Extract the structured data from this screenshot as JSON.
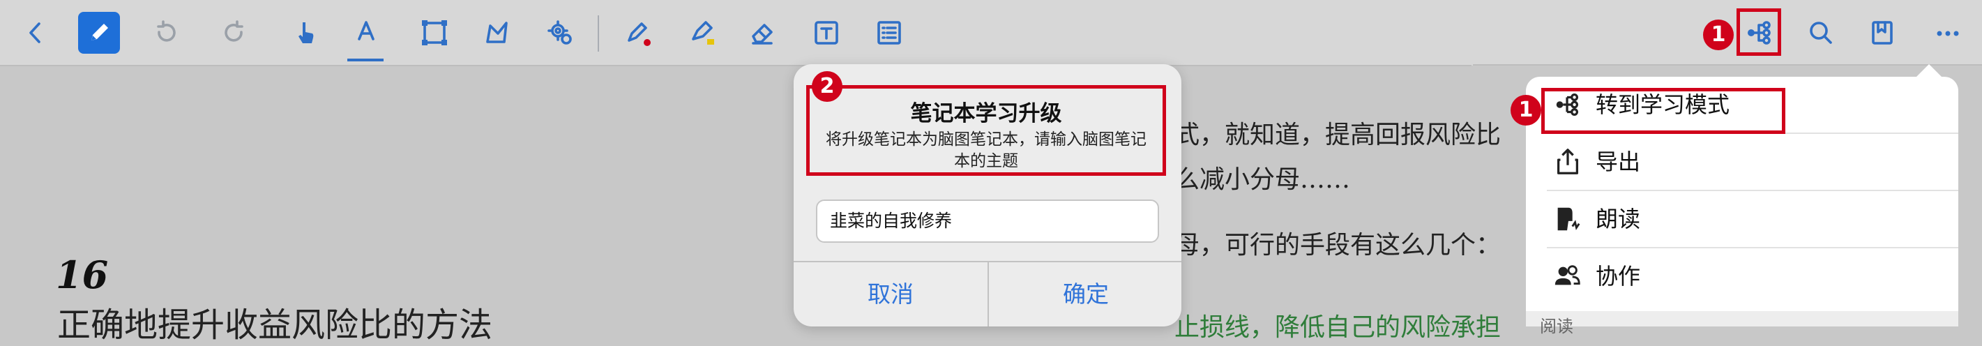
{
  "toolbar": {
    "icons": [
      "back-icon",
      "pencil-icon",
      "undo-icon",
      "redo-icon",
      "hand-icon",
      "text-color-icon",
      "select-rect-icon",
      "lasso-icon",
      "settings-icon",
      "pen-red-icon",
      "highlighter-icon",
      "eraser-icon",
      "textbox-icon",
      "list-icon"
    ],
    "accent": "#2f6fc6"
  },
  "document": {
    "chapter_number": "16",
    "chapter_title": "正确地提升收益风险比的方法",
    "line1": "式，就知道，提高回报风险比",
    "line2": "么减小分母……",
    "line3": "母，可行的手段有这么几个：",
    "line4": "止损线，降低自己的风险承担"
  },
  "dialog": {
    "badge": "2",
    "title": "笔记本学习升级",
    "message": "将升级笔记本为脑图笔记本，请输入脑图笔记本的主题",
    "input_value": "韭菜的自我修养",
    "cancel_label": "取消",
    "confirm_label": "确定"
  },
  "top_right": {
    "badge": "1",
    "icons": [
      "mindmap-icon",
      "search-icon",
      "bookmark-icon",
      "more-icon"
    ]
  },
  "menu": {
    "badge": "1",
    "items": [
      {
        "label": "转到学习模式",
        "icon": "mindmap-icon"
      },
      {
        "label": "导出",
        "icon": "share-icon"
      },
      {
        "label": "朗读",
        "icon": "read-aloud-icon"
      },
      {
        "label": "协作",
        "icon": "collaborate-icon"
      }
    ],
    "section_label": "阅读"
  },
  "colors": {
    "highlight_red": "#d0021b",
    "button_blue": "#2f73d9"
  }
}
